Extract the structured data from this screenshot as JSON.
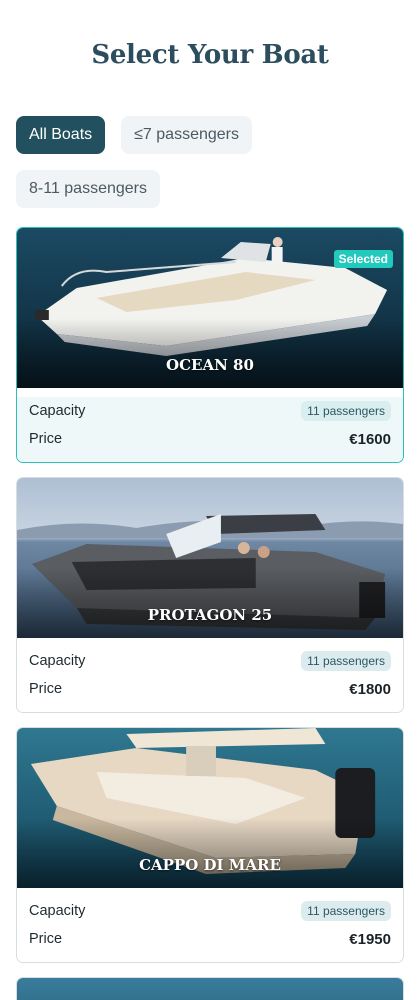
{
  "page": {
    "title": "Select Your Boat"
  },
  "filters": [
    {
      "label": "All Boats",
      "active": true
    },
    {
      "label": "≤7 passengers",
      "active": false
    },
    {
      "label": "8-11 passengers",
      "active": false
    }
  ],
  "labels": {
    "capacity": "Capacity",
    "price": "Price",
    "selected_badge": "Selected"
  },
  "boats": [
    {
      "name": "OCEAN 80",
      "capacity": "11 passengers",
      "price": "€1600",
      "selected": true
    },
    {
      "name": "PROTAGON 25",
      "capacity": "11 passengers",
      "price": "€1800",
      "selected": false
    },
    {
      "name": "CAPPO DI MARE",
      "capacity": "11 passengers",
      "price": "€1950",
      "selected": false
    }
  ],
  "colors": {
    "accent": "#22505f",
    "selected_border": "#2ac2b8",
    "title": "#2b4d5e"
  }
}
